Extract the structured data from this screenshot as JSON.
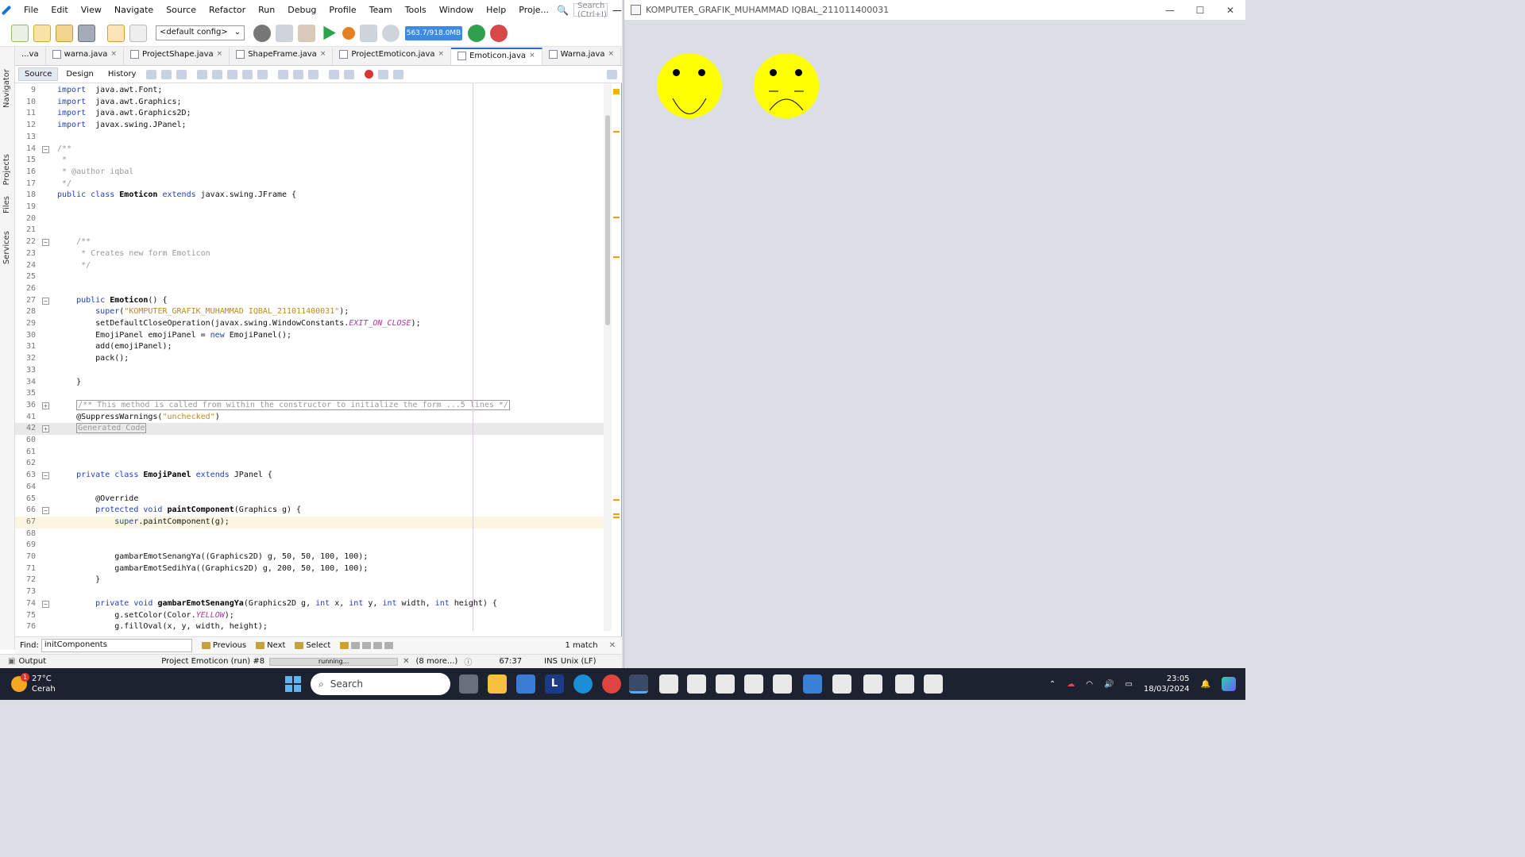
{
  "ide": {
    "menu": [
      "File",
      "Edit",
      "View",
      "Navigate",
      "Source",
      "Refactor",
      "Run",
      "Debug",
      "Profile",
      "Team",
      "Tools",
      "Window",
      "Help",
      "Proje..."
    ],
    "search_placeholder": "Search (Ctrl+I)",
    "config": "<default config>",
    "memory": "563.7/918.0MB",
    "side_tabs": [
      "Navigator",
      "Projects",
      "Files",
      "Services"
    ],
    "tabs": [
      {
        "label": "...va",
        "close": ""
      },
      {
        "label": "warna.java",
        "close": "×"
      },
      {
        "label": "ProjectShape.java",
        "close": "×"
      },
      {
        "label": "ShapeFrame.java",
        "close": "×"
      },
      {
        "label": "ProjectEmoticon.java",
        "close": "×"
      },
      {
        "label": "Emoticon.java",
        "close": "×"
      },
      {
        "label": "Warna.java",
        "close": "×"
      }
    ],
    "editor_modes": [
      "Source",
      "Design",
      "History"
    ],
    "lines": [
      {
        "n": "9",
        "fold": "",
        "hl": "",
        "code": [
          [
            "kw",
            "import"
          ],
          [
            "",
            "  java.awt.Font;"
          ]
        ]
      },
      {
        "n": "10",
        "fold": "",
        "hl": "",
        "code": [
          [
            "kw",
            "import"
          ],
          [
            "",
            "  java.awt.Graphics;"
          ]
        ]
      },
      {
        "n": "11",
        "fold": "",
        "hl": "",
        "code": [
          [
            "kw",
            "import"
          ],
          [
            "",
            "  java.awt.Graphics2D;"
          ]
        ]
      },
      {
        "n": "12",
        "fold": "",
        "hl": "",
        "code": [
          [
            "kw",
            "import"
          ],
          [
            "",
            "  javax.swing.JPanel;"
          ]
        ]
      },
      {
        "n": "13",
        "fold": "",
        "hl": "",
        "code": []
      },
      {
        "n": "14",
        "fold": "−",
        "hl": "",
        "code": [
          [
            "cm",
            "/**"
          ]
        ]
      },
      {
        "n": "15",
        "fold": "",
        "hl": "",
        "code": [
          [
            "cm",
            " *"
          ]
        ]
      },
      {
        "n": "16",
        "fold": "",
        "hl": "",
        "code": [
          [
            "cm",
            " * @author iqbal"
          ]
        ]
      },
      {
        "n": "17",
        "fold": "",
        "hl": "",
        "code": [
          [
            "cm",
            " */"
          ]
        ]
      },
      {
        "n": "18",
        "fold": "",
        "hl": "",
        "code": [
          [
            "kw",
            "public class "
          ],
          [
            "bd",
            "Emoticon"
          ],
          [
            "kw",
            " extends "
          ],
          [
            "",
            "javax.swing.JFrame {"
          ]
        ]
      },
      {
        "n": "19",
        "fold": "",
        "hl": "",
        "code": []
      },
      {
        "n": "20",
        "fold": "",
        "hl": "",
        "code": []
      },
      {
        "n": "21",
        "fold": "",
        "hl": "",
        "code": []
      },
      {
        "n": "22",
        "fold": "−",
        "hl": "",
        "code": [
          [
            "cm",
            "    /**"
          ]
        ]
      },
      {
        "n": "23",
        "fold": "",
        "hl": "",
        "code": [
          [
            "cm",
            "     * Creates new form Emoticon"
          ]
        ]
      },
      {
        "n": "24",
        "fold": "",
        "hl": "",
        "code": [
          [
            "cm",
            "     */"
          ]
        ]
      },
      {
        "n": "25",
        "fold": "",
        "hl": "",
        "code": []
      },
      {
        "n": "26",
        "fold": "",
        "hl": "",
        "code": []
      },
      {
        "n": "27",
        "fold": "−",
        "hl": "",
        "code": [
          [
            "kw",
            "    public "
          ],
          [
            "bd",
            "Emoticon"
          ],
          [
            "",
            "() {"
          ]
        ]
      },
      {
        "n": "28",
        "fold": "",
        "hl": "",
        "code": [
          [
            "kw",
            "        super"
          ],
          [
            "",
            "("
          ],
          [
            "st",
            "\"KOMPUTER_GRAFIK_MUHAMMAD IQBAL_211011400031\""
          ],
          [
            "",
            ");"
          ]
        ]
      },
      {
        "n": "29",
        "fold": "",
        "hl": "",
        "code": [
          [
            "",
            "        setDefaultCloseOperation(javax.swing.WindowConstants."
          ],
          [
            "it",
            "EXIT_ON_CLOSE"
          ],
          [
            "",
            ");"
          ]
        ]
      },
      {
        "n": "30",
        "fold": "",
        "hl": "",
        "code": [
          [
            "",
            "        EmojiPanel emojiPanel = "
          ],
          [
            "kw",
            "new"
          ],
          [
            "",
            " EmojiPanel();"
          ]
        ]
      },
      {
        "n": "31",
        "fold": "",
        "hl": "",
        "code": [
          [
            "",
            "        add(emojiPanel);"
          ]
        ]
      },
      {
        "n": "32",
        "fold": "",
        "hl": "",
        "code": [
          [
            "",
            "        pack();"
          ]
        ]
      },
      {
        "n": "33",
        "fold": "",
        "hl": "",
        "code": []
      },
      {
        "n": "34",
        "fold": "",
        "hl": "",
        "code": [
          [
            "",
            "    }"
          ]
        ]
      },
      {
        "n": "35",
        "fold": "",
        "hl": "",
        "code": []
      },
      {
        "n": "36",
        "fold": "+",
        "hl": "",
        "code": [
          [
            "",
            "    "
          ],
          [
            "folded",
            "/** This method is called from within the constructor to initialize the form ...5 lines */"
          ]
        ]
      },
      {
        "n": "41",
        "fold": "",
        "hl": "",
        "code": [
          [
            "",
            "    @SuppressWarnings("
          ],
          [
            "st",
            "\"unchecked\""
          ],
          [
            "",
            ")"
          ]
        ]
      },
      {
        "n": "42",
        "fold": "+",
        "hl": "grey",
        "code": [
          [
            "",
            "    "
          ],
          [
            "folded",
            "Generated Code"
          ]
        ]
      },
      {
        "n": "60",
        "fold": "",
        "hl": "",
        "code": []
      },
      {
        "n": "61",
        "fold": "",
        "hl": "",
        "code": []
      },
      {
        "n": "62",
        "fold": "",
        "hl": "",
        "code": []
      },
      {
        "n": "63",
        "fold": "−",
        "hl": "",
        "code": [
          [
            "kw",
            "    private class "
          ],
          [
            "bd",
            "EmojiPanel"
          ],
          [
            "kw",
            " extends "
          ],
          [
            "",
            "JPanel {"
          ]
        ]
      },
      {
        "n": "64",
        "fold": "",
        "hl": "",
        "code": []
      },
      {
        "n": "65",
        "fold": "",
        "hl": "",
        "code": [
          [
            "",
            "        @Override"
          ]
        ]
      },
      {
        "n": "66",
        "fold": "−",
        "hl": "",
        "code": [
          [
            "kw",
            "        protected void "
          ],
          [
            "bd",
            "paintComponent"
          ],
          [
            "",
            "(Graphics g) {"
          ]
        ]
      },
      {
        "n": "67",
        "fold": "",
        "hl": "hl",
        "code": [
          [
            "kw",
            "            super"
          ],
          [
            "",
            ".paintComponent(g);"
          ]
        ]
      },
      {
        "n": "68",
        "fold": "",
        "hl": "",
        "code": []
      },
      {
        "n": "69",
        "fold": "",
        "hl": "",
        "code": []
      },
      {
        "n": "70",
        "fold": "",
        "hl": "",
        "code": [
          [
            "",
            "            gambarEmotSenangYa((Graphics2D) g, 50, 50, 100, 100);"
          ]
        ]
      },
      {
        "n": "71",
        "fold": "",
        "hl": "",
        "code": [
          [
            "",
            "            gambarEmotSedihYa((Graphics2D) g, 200, 50, 100, 100);"
          ]
        ]
      },
      {
        "n": "72",
        "fold": "",
        "hl": "",
        "code": [
          [
            "",
            "        }"
          ]
        ]
      },
      {
        "n": "73",
        "fold": "",
        "hl": "",
        "code": []
      },
      {
        "n": "74",
        "fold": "−",
        "hl": "",
        "code": [
          [
            "kw",
            "        private void "
          ],
          [
            "bd",
            "gambarEmotSenangYa"
          ],
          [
            "",
            "(Graphics2D g, "
          ],
          [
            "kw",
            "int"
          ],
          [
            "",
            " x, "
          ],
          [
            "kw",
            "int"
          ],
          [
            "",
            " y, "
          ],
          [
            "kw",
            "int"
          ],
          [
            "",
            " width, "
          ],
          [
            "kw",
            "int"
          ],
          [
            "",
            " height) {"
          ]
        ]
      },
      {
        "n": "75",
        "fold": "",
        "hl": "",
        "code": [
          [
            "",
            "            g.setColor(Color."
          ],
          [
            "it",
            "YELLOW"
          ],
          [
            "",
            ");"
          ]
        ]
      },
      {
        "n": "76",
        "fold": "",
        "hl": "",
        "code": [
          [
            "",
            "            g.fillOval(x, y, width, height);"
          ]
        ]
      }
    ],
    "find": {
      "label": "Find:",
      "value": "initComponents",
      "previous": "Previous",
      "next": "Next",
      "select": "Select",
      "matches": "1 match"
    },
    "status": {
      "output": "Output",
      "task": "Project Emoticon (run) #8",
      "progress_text": "running...",
      "more": "(8 more...)",
      "position": "67:37",
      "insert_mode": "INS",
      "line_endings": "Unix (LF)"
    }
  },
  "app_window": {
    "title": "KOMPUTER_GRAFIK_MUHAMMAD IQBAL_211011400031",
    "controls": [
      "—",
      "☐",
      "✕"
    ],
    "emoji_color": "#ffff00"
  },
  "taskbar": {
    "temperature": "27°C",
    "weather": "Cerah",
    "weather_badge": "1",
    "search": "Search",
    "time": "23:05",
    "date": "18/03/2024"
  }
}
